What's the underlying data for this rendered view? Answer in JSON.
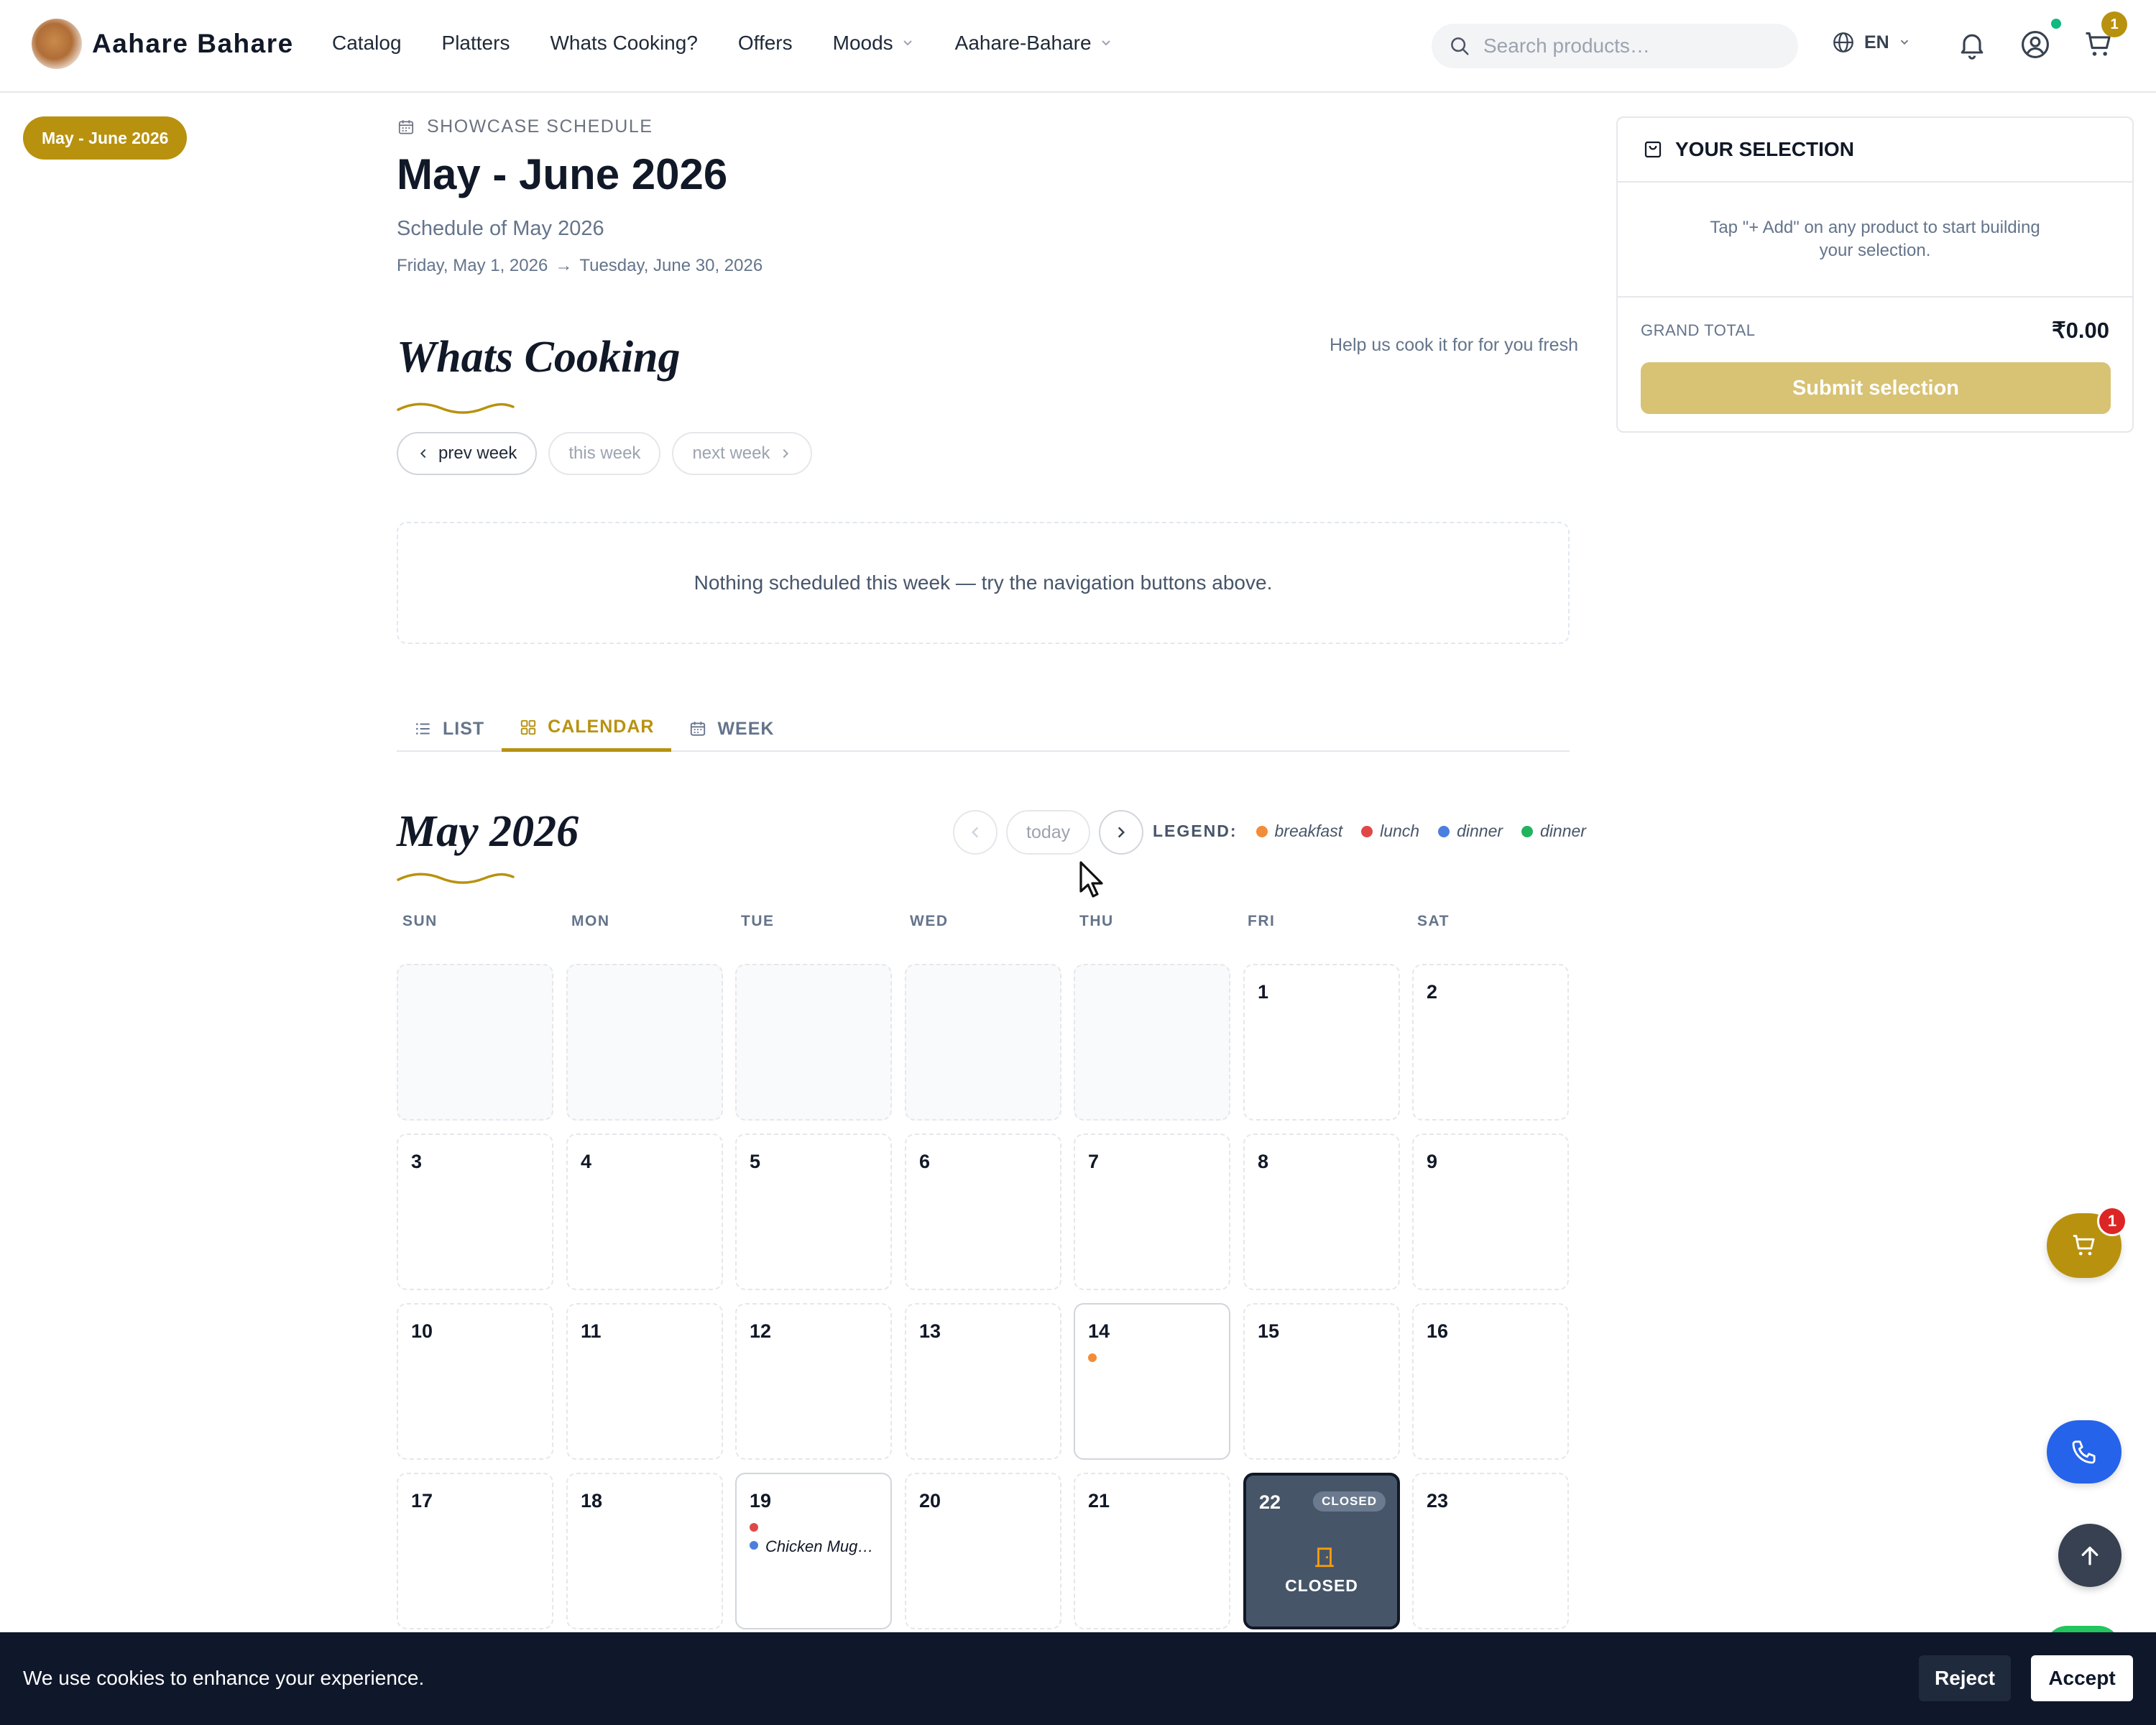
{
  "header": {
    "brand": "Aahare Bahare",
    "nav": [
      {
        "label": "Catalog",
        "has_dropdown": false
      },
      {
        "label": "Platters",
        "has_dropdown": false
      },
      {
        "label": "Whats Cooking?",
        "has_dropdown": false
      },
      {
        "label": "Offers",
        "has_dropdown": false
      },
      {
        "label": "Moods",
        "has_dropdown": true
      },
      {
        "label": "Aahare-Bahare",
        "has_dropdown": true
      }
    ],
    "search_placeholder": "Search products…",
    "language": "EN",
    "cart_count": "1",
    "icons": [
      "search-icon",
      "globe-icon",
      "bell-icon",
      "user-icon",
      "cart-icon"
    ]
  },
  "sidebar": {
    "period_pill": "May - June 2026"
  },
  "showcase": {
    "eyebrow": "SHOWCASE SCHEDULE",
    "title": "May - June 2026",
    "subtitle": "Schedule of May 2026",
    "start_date": "Friday, May 1, 2026",
    "arrow": "→",
    "end_date": "Tuesday, June 30, 2026"
  },
  "whats_cooking": {
    "title": "Whats Cooking",
    "help_text": "Help us cook it for for you fresh",
    "prev_week": "prev week",
    "this_week": "this week",
    "next_week": "next week",
    "empty_message": "Nothing scheduled this week — try the navigation buttons above."
  },
  "view_tabs": [
    {
      "label": "LIST",
      "icon": "list-icon",
      "active": false
    },
    {
      "label": "CALENDAR",
      "icon": "grid-icon",
      "active": true
    },
    {
      "label": "WEEK",
      "icon": "calendar-icon",
      "active": false
    }
  ],
  "calendar": {
    "month_title": "May 2026",
    "today_label": "today",
    "legend_label": "LEGEND:",
    "legend": [
      {
        "label": "breakfast",
        "color": "#f28c38"
      },
      {
        "label": "lunch",
        "color": "#e04848"
      },
      {
        "label": "dinner",
        "color": "#4a7fe0"
      },
      {
        "label": "dinner",
        "color": "#22b35e"
      }
    ],
    "weekdays": [
      "SUN",
      "MON",
      "TUE",
      "WED",
      "THU",
      "FRI",
      "SAT"
    ],
    "weeks": [
      [
        null,
        null,
        null,
        null,
        null,
        {
          "day": "1"
        },
        {
          "day": "2"
        }
      ],
      [
        {
          "day": "3"
        },
        {
          "day": "4"
        },
        {
          "day": "5"
        },
        {
          "day": "6"
        },
        {
          "day": "7"
        },
        {
          "day": "8"
        },
        {
          "day": "9"
        }
      ],
      [
        {
          "day": "10"
        },
        {
          "day": "11"
        },
        {
          "day": "12"
        },
        {
          "day": "13"
        },
        {
          "day": "14",
          "dots": [
            "#f28c38"
          ]
        },
        {
          "day": "15"
        },
        {
          "day": "16"
        }
      ],
      [
        {
          "day": "17"
        },
        {
          "day": "18"
        },
        {
          "day": "19",
          "dots": [
            "#e04848",
            "#4a7fe0"
          ],
          "event": "Chicken Mug…"
        },
        {
          "day": "20"
        },
        {
          "day": "21"
        },
        {
          "day": "22",
          "closed": true
        },
        {
          "day": "23"
        }
      ]
    ],
    "closed_badge": "CLOSED",
    "closed_label": "CLOSED"
  },
  "selection": {
    "title": "YOUR SELECTION",
    "empty_text": "Tap \"+ Add\" on any product to start building your selection.",
    "grand_total_label": "GRAND TOTAL",
    "grand_total_value": "₹0.00",
    "submit_label": "Submit selection"
  },
  "floating": {
    "cart_count": "1"
  },
  "cookie": {
    "message": "We use cookies to enhance your experience.",
    "reject": "Reject",
    "accept": "Accept"
  },
  "colors": {
    "accent": "#b8920f",
    "closed_cell": "#475569",
    "phone_button": "#2563eb",
    "cookie_bar": "#0f172a"
  }
}
